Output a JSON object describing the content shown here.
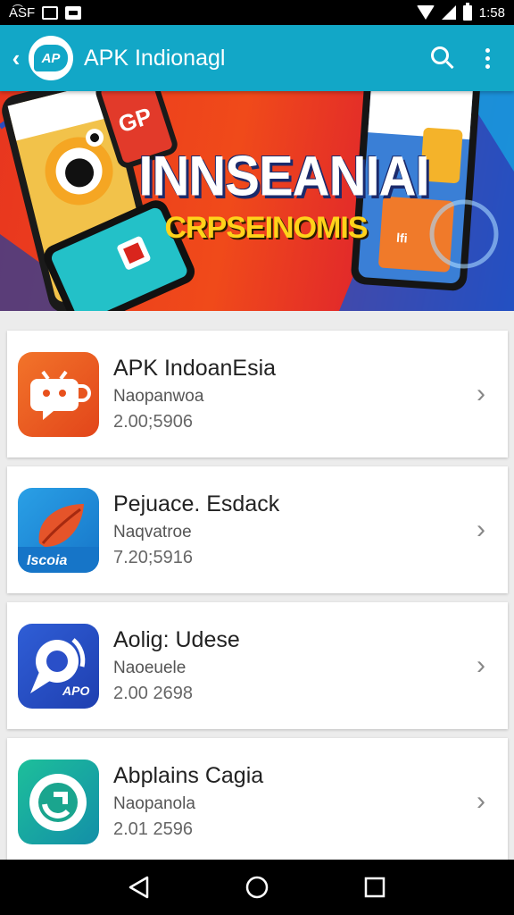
{
  "status_bar": {
    "left_text": "A͡SF",
    "time": "1:58"
  },
  "app_bar": {
    "logo_text": "AP",
    "title": "APK Indionagl"
  },
  "banner": {
    "title": "INNSEANIAI",
    "subtitle": "CRPSEINOMIS"
  },
  "apps": [
    {
      "title": "APK IndoanEsia",
      "developer": "Naopanwoa",
      "number": "2.00;5906",
      "icon": "chat-bubble-icon",
      "color": "#ee5a1c"
    },
    {
      "title": "Pejuace. Esdack",
      "developer": "Naqvatroe",
      "number": "7.20;5916",
      "icon": "leaf-icon",
      "color": "#1f8ed6"
    },
    {
      "title": "Aolig: Udese",
      "developer": "Naoeuele",
      "number": "2.00 2698",
      "icon": "location-pin-icon",
      "color": "#2c4fd0"
    },
    {
      "title": "Abplains Cagia",
      "developer": "Naopanola",
      "number": "2.01 2596",
      "icon": "refresh-icon",
      "color": "#1aa5a0"
    }
  ]
}
